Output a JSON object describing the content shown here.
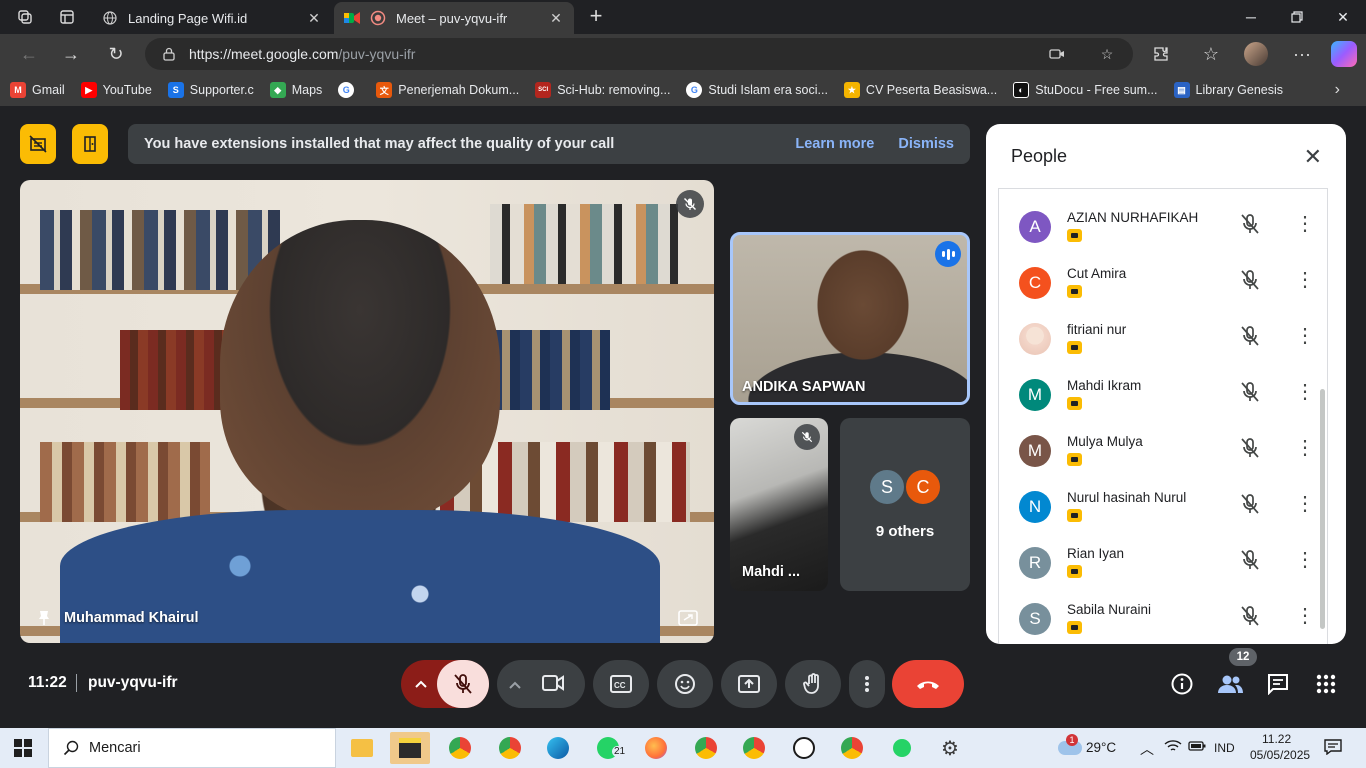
{
  "browser": {
    "tabs": [
      {
        "title": "Landing Page Wifi.id",
        "active": false
      },
      {
        "title": "Meet – puv-yqvu-ifr",
        "active": true
      }
    ],
    "url_host": "https://meet.google.com",
    "url_path": "/puv-yqvu-ifr",
    "bookmarks": [
      {
        "label": "Gmail",
        "icon": "gmail-icon",
        "color": "#ea4335"
      },
      {
        "label": "YouTube",
        "icon": "youtube-icon",
        "color": "#ff0000"
      },
      {
        "label": "Supporter.c",
        "icon": "supporter-icon",
        "color": "#1a73e8"
      },
      {
        "label": "Maps",
        "icon": "maps-icon",
        "color": "#34a853"
      },
      {
        "label": "",
        "icon": "google-icon",
        "color": "#ffffff"
      },
      {
        "label": "Penerjemah Dokum...",
        "icon": "translate-icon",
        "color": "#e8590c"
      },
      {
        "label": "Sci-Hub: removing...",
        "icon": "scihub-icon",
        "color": "#b3261e"
      },
      {
        "label": "Studi Islam era soci...",
        "icon": "google-icon",
        "color": "#ffffff"
      },
      {
        "label": "CV Peserta Beasiswa...",
        "icon": "beasiswa-icon",
        "color": "#f4b400"
      },
      {
        "label": "StuDocu - Free sum...",
        "icon": "studocu-icon",
        "color": "#111111"
      },
      {
        "label": "Library Genesis",
        "icon": "libgen-icon",
        "color": "#2b63c4"
      }
    ]
  },
  "meet": {
    "banner": {
      "message": "You have extensions installed that may affect the quality of your call",
      "learn_more": "Learn more",
      "dismiss": "Dismiss"
    },
    "tiles": {
      "main_name": "Muhammad Khairul",
      "andika_name": "ANDIKA SAPWAN",
      "mahdi_name": "Mahdi ...",
      "others_label": "9 others",
      "others_avatars": [
        {
          "letter": "S",
          "color": "#5f7a8a"
        },
        {
          "letter": "C",
          "color": "#e8590c"
        }
      ]
    },
    "people": {
      "title": "People",
      "participants": [
        {
          "name": "AZIAN NURHAFIKAH",
          "initial": "A",
          "color": "#7e57c2"
        },
        {
          "name": "Cut Amira",
          "initial": "C",
          "color": "#f4511e"
        },
        {
          "name": "fitriani nur",
          "initial": "",
          "color": "#f3d6c9"
        },
        {
          "name": "Mahdi Ikram",
          "initial": "M",
          "color": "#00897b"
        },
        {
          "name": "Mulya Mulya",
          "initial": "M",
          "color": "#795548"
        },
        {
          "name": "Nurul hasinah Nurul",
          "initial": "N",
          "color": "#0288d1"
        },
        {
          "name": "Rian Iyan",
          "initial": "R",
          "color": "#78909c"
        },
        {
          "name": "Sabila Nuraini",
          "initial": "S",
          "color": "#78909c"
        }
      ]
    },
    "controls": {
      "time": "11:22",
      "meeting_code": "puv-yqvu-ifr",
      "people_count": "12"
    }
  },
  "taskbar": {
    "search_placeholder": "Mencari",
    "weather_temp": "29°C",
    "weather_alert": "1",
    "language": "IND",
    "time": "11.22",
    "date": "05/05/2025",
    "whatsapp_count": "21"
  }
}
